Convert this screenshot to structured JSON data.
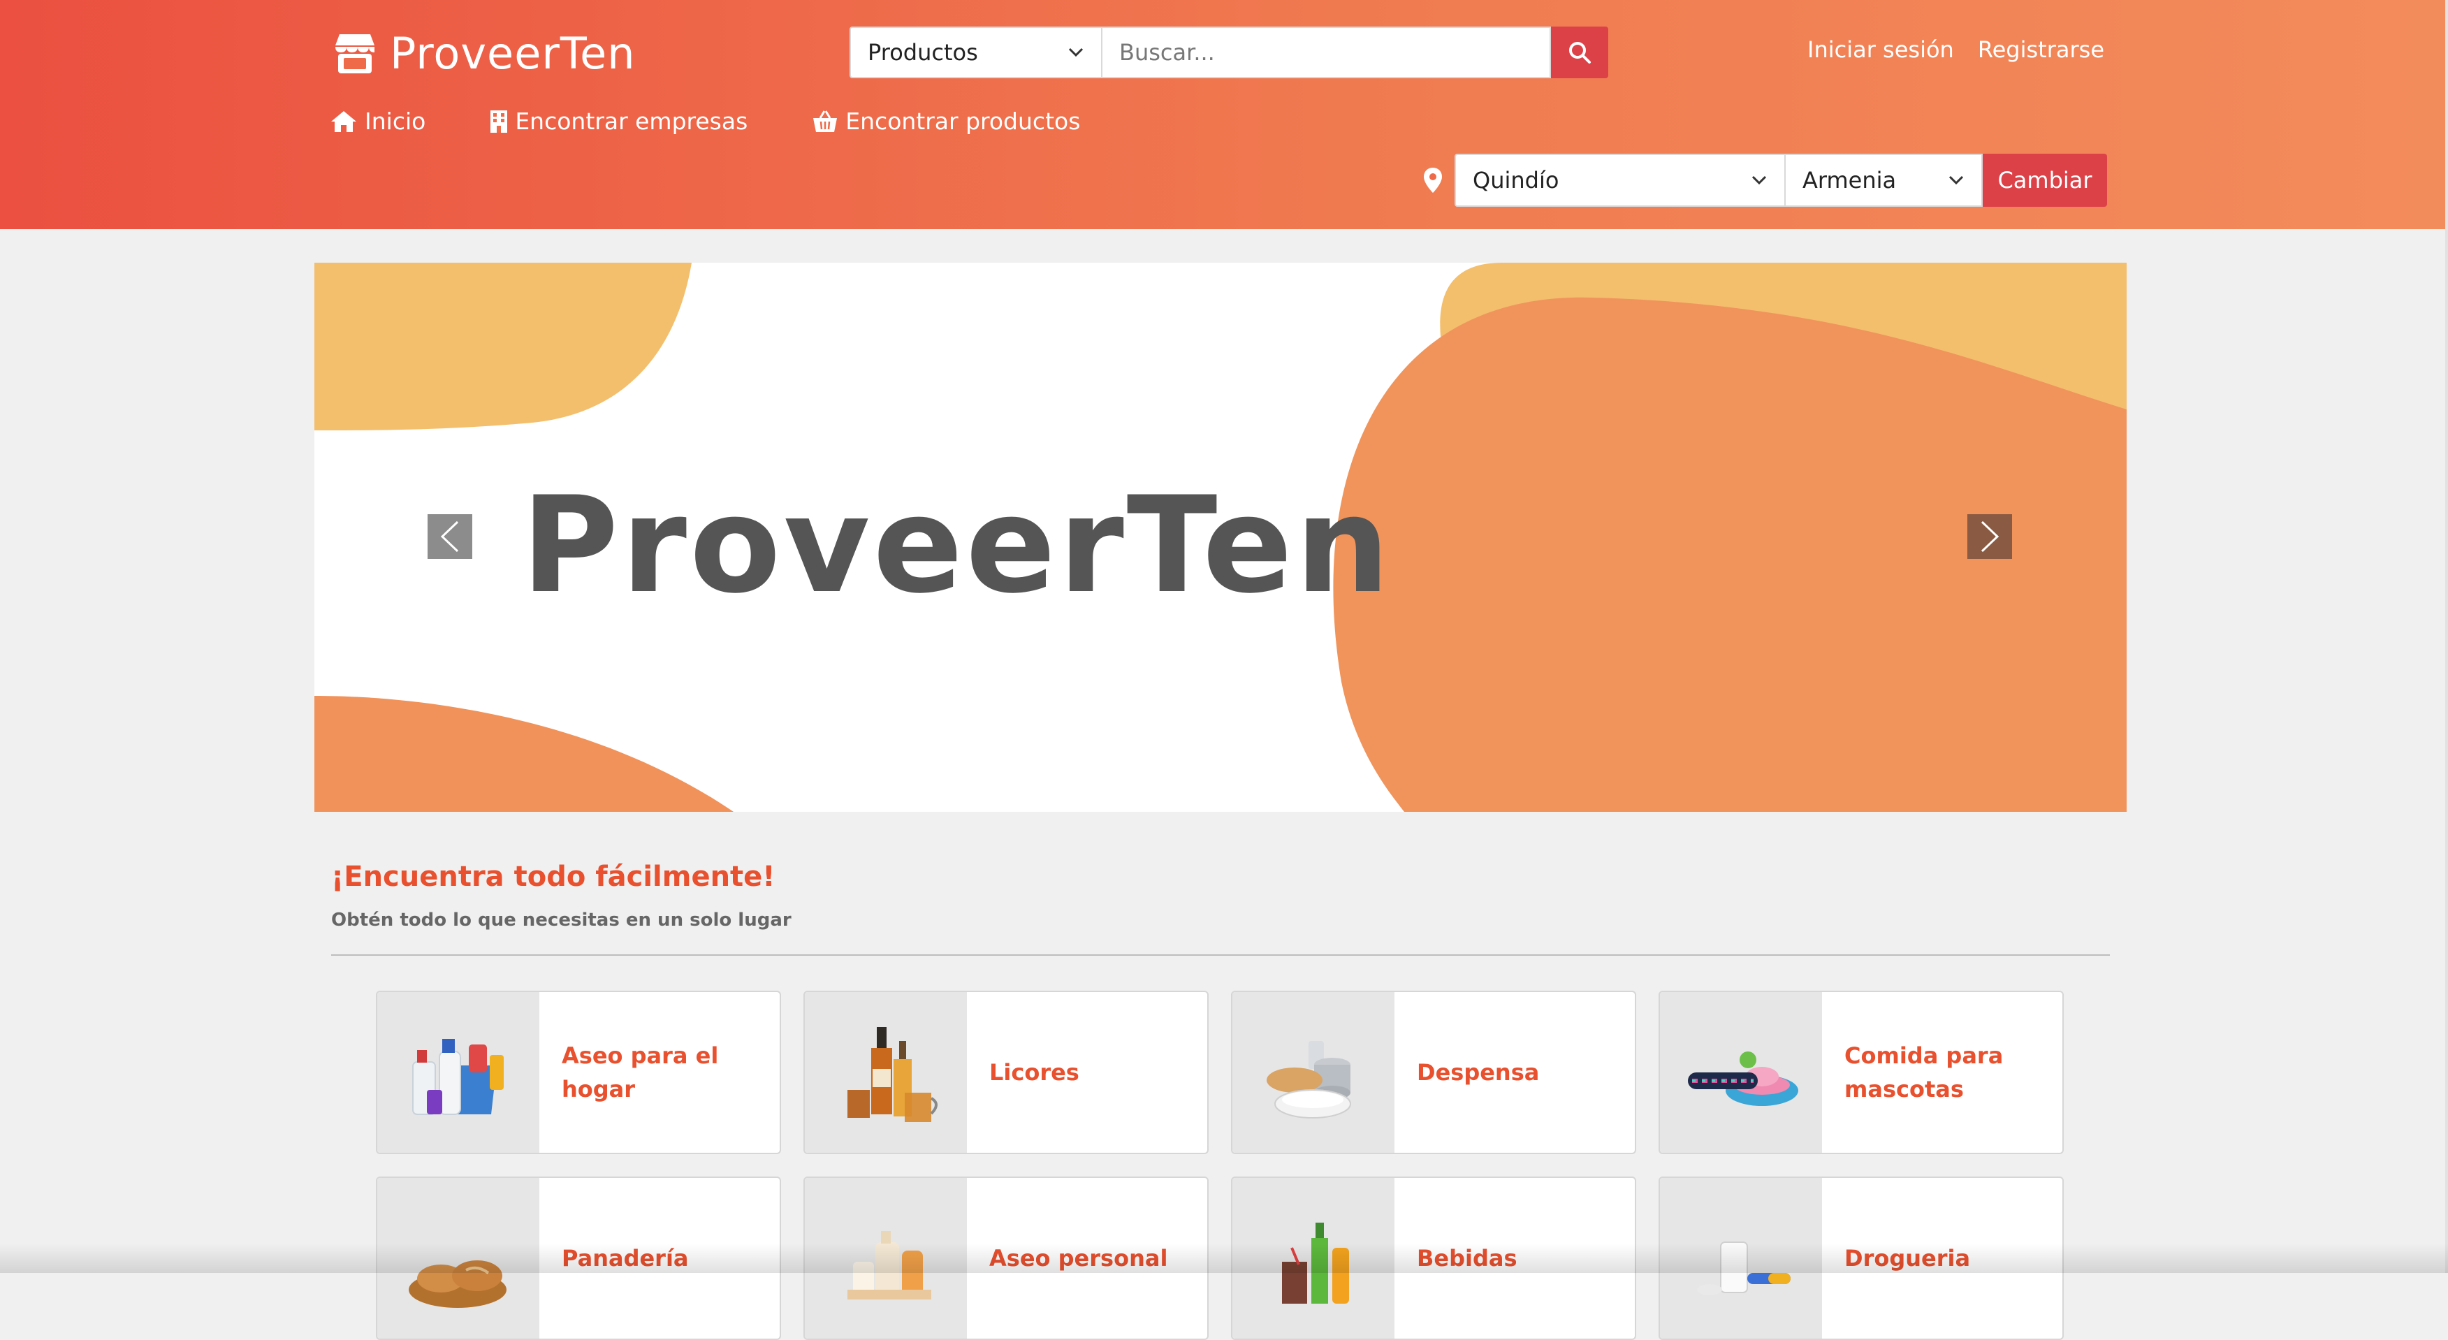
{
  "header": {
    "brand": "ProveerTen",
    "search": {
      "category_selected": "Productos",
      "placeholder": "Buscar..."
    },
    "auth": {
      "login": "Iniciar sesión",
      "register": "Registrarse"
    },
    "nav": [
      {
        "label": "Inicio",
        "icon": "home-icon"
      },
      {
        "label": "Encontrar empresas",
        "icon": "building-icon"
      },
      {
        "label": "Encontrar productos",
        "icon": "basket-icon"
      }
    ],
    "location": {
      "department": "Quindío",
      "city": "Armenia",
      "change_label": "Cambiar"
    }
  },
  "banner": {
    "title": "ProveerTen"
  },
  "section": {
    "title": "¡Encuentra todo fácilmente!",
    "subtitle": "Obtén todo lo que necesitas en un solo lugar"
  },
  "categories": [
    {
      "label": "Aseo para el hogar",
      "icon": "cleaning-products-icon"
    },
    {
      "label": "Licores",
      "icon": "liquor-bottles-icon"
    },
    {
      "label": "Despensa",
      "icon": "pantry-icon"
    },
    {
      "label": "Comida para mascotas",
      "icon": "pet-food-icon"
    },
    {
      "label": "Panadería",
      "icon": "bread-icon"
    },
    {
      "label": "Aseo personal",
      "icon": "personal-care-icon"
    },
    {
      "label": "Bebidas",
      "icon": "beverages-icon"
    },
    {
      "label": "Drogueria",
      "icon": "pharmacy-icon"
    }
  ],
  "colors": {
    "accent": "#dc4148",
    "header_start": "#eb5040",
    "header_end": "#f38c5b",
    "category_text": "#e8502e"
  }
}
